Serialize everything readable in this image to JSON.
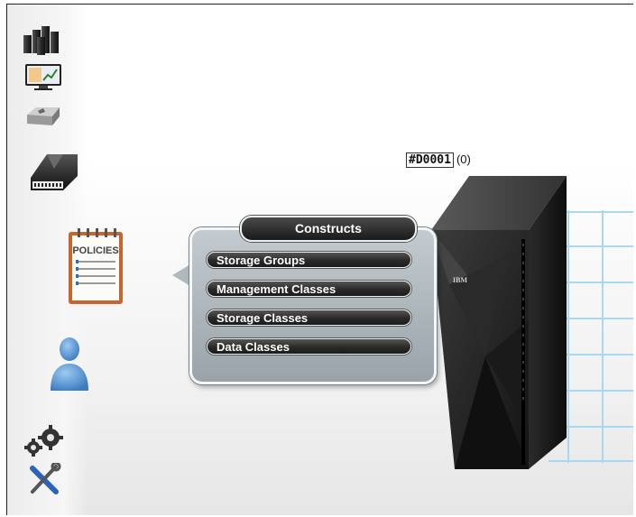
{
  "popup": {
    "title": "Constructs",
    "items": [
      {
        "label": "Storage Groups"
      },
      {
        "label": "Management Classes"
      },
      {
        "label": "Storage Classes"
      },
      {
        "label": "Data Classes"
      }
    ]
  },
  "device": {
    "id": "#D0001",
    "count": "(0)",
    "brand": "IBM"
  },
  "sidebar": {
    "policies_label": "POLICIES",
    "icons": [
      "servers-icon",
      "monitor-dashboard-icon",
      "disk-drive-icon",
      "tape-library-icon",
      "policies-clipboard-icon",
      "user-icon",
      "gears-icon",
      "tools-icon"
    ]
  }
}
